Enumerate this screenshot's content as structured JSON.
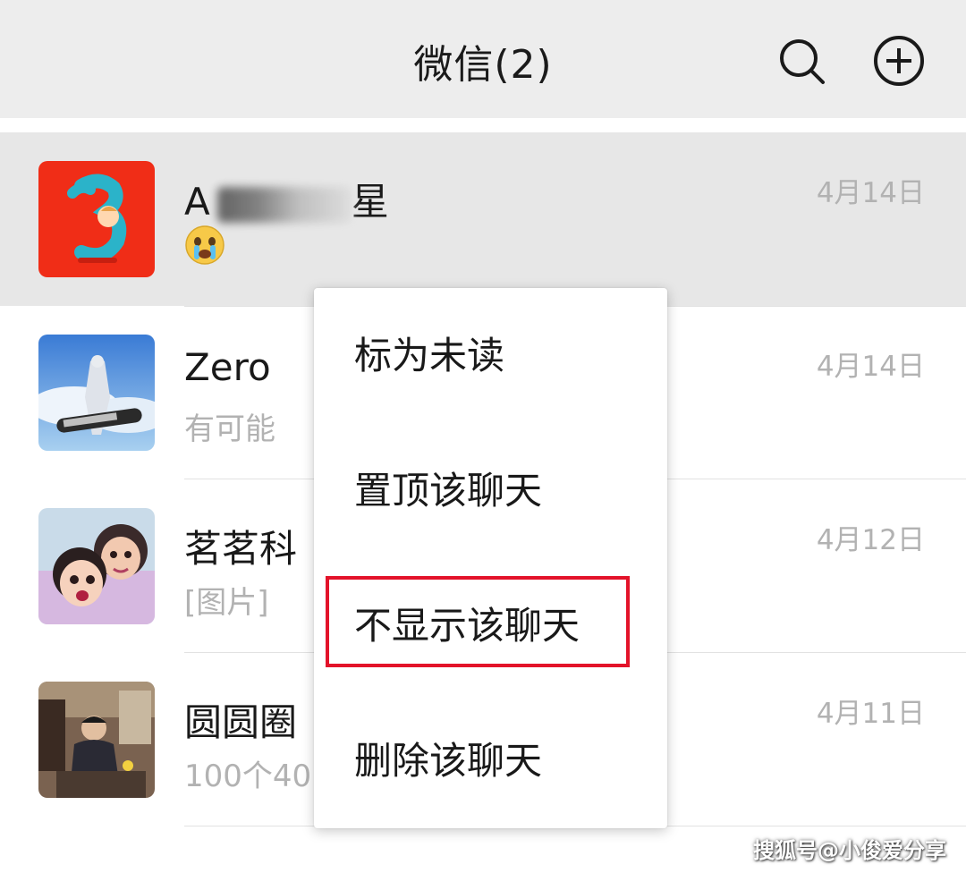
{
  "header": {
    "title": "微信(2)",
    "search_icon": "search-icon",
    "add_icon": "plus-circle-icon"
  },
  "chats": [
    {
      "name": "A",
      "name_suffix": "星",
      "preview": "😭",
      "date": "4月14日",
      "avatar": "red-tile-number-3-avatar"
    },
    {
      "name": "Zero",
      "preview": "有可能",
      "date": "4月14日",
      "avatar": "snowboarder-photo-avatar"
    },
    {
      "name": "茗茗科",
      "preview": "[图片]",
      "date": "4月12日",
      "avatar": "two-girls-photo-avatar"
    },
    {
      "name": "圆圆圈",
      "preview": "100个40",
      "date": "4月11日",
      "avatar": "man-at-desk-photo-avatar"
    }
  ],
  "context_menu": {
    "items": [
      "标为未读",
      "置顶该聊天",
      "不显示该聊天",
      "删除该聊天"
    ],
    "highlighted_index": 2,
    "highlight_color": "#e3132a"
  },
  "watermark": "搜狐号@小俊爱分享"
}
